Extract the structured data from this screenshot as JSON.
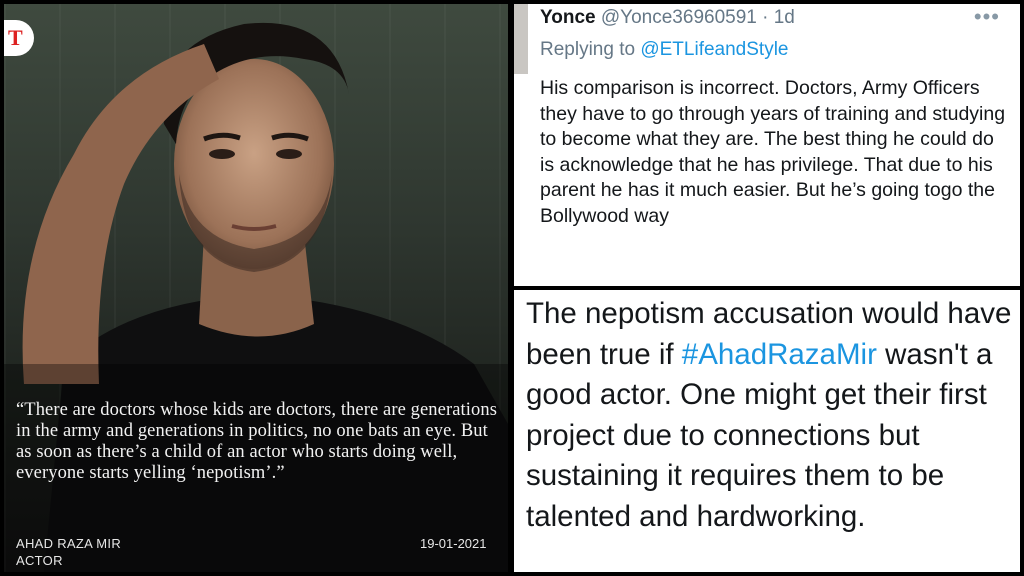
{
  "left_panel": {
    "logo_letter": "T",
    "quote": "“There are doctors whose kids are doctors, there are generations in the army and generations in politics, no one bats an eye. But as soon as there’s a child of an actor who starts doing well, everyone starts yelling ‘nepotism’.”",
    "author_name": "AHAD RAZA MIR",
    "author_role": "ACTOR",
    "date": "19-01-2021"
  },
  "reply_tweet": {
    "display_name": "Yonce",
    "handle_time": " @Yonce36960591 · 1d",
    "more_label": "•••",
    "replying_prefix": "Replying to ",
    "replying_handle": "@ETLifeandStyle",
    "text": "His comparison is incorrect. Doctors, Army Officers they have to go through years of training and studying to become what they are. The best thing he could do is acknowledge that he has privilege. That due to his parent he has it much easier. But he’s going togo the Bollywood way"
  },
  "main_tweet": {
    "text_before": "The nepotism accusation would have been true if ",
    "hashtag": "#AhadRazaMir",
    "text_after": " wasn't a good actor. One might get their first project due to connections but sustaining it requires them to be talented and hardworking."
  },
  "colors": {
    "link_blue": "#1b95e0",
    "text_dark": "#14171a",
    "text_gray": "#657786",
    "logo_red": "#dd2222"
  }
}
